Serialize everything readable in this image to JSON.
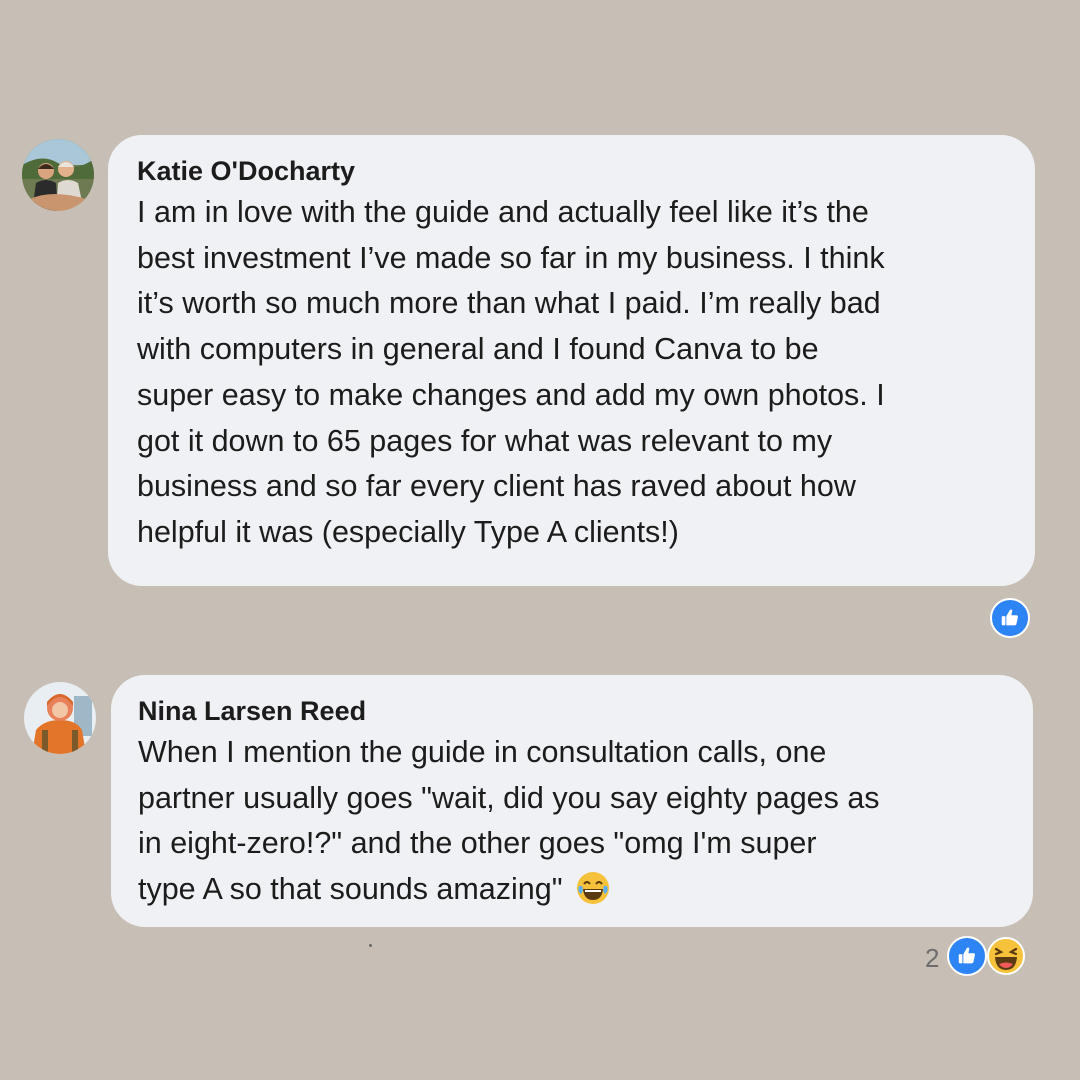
{
  "comments": [
    {
      "author": "Katie O'Docharty",
      "avatar_icon": "profile-photo-avatar",
      "lines": [
        "I am in love with the guide and actually feel like it’s the",
        "best investment I’ve made so far in my business. I think",
        "it’s worth so much more than what I paid. I’m really bad",
        "with computers in general and I found Canva to be",
        "super easy to make changes and add my own photos. I",
        "got it down to 65 pages for what was relevant to my",
        "business and so far every client has raved about how",
        "helpful it was (especially Type A clients!)"
      ],
      "reactions": [
        "like-icon"
      ]
    },
    {
      "author": "Nina Larsen Reed",
      "avatar_icon": "profile-photo-avatar",
      "lines": [
        "When I mention the guide in consultation calls, one",
        "partner usually goes \"wait, did you say eighty pages as",
        "in eight-zero!?\" and the other goes \"omg I'm super",
        "type A so that sounds amazing\""
      ],
      "inline_emoji": "tears-of-joy-emoji-icon",
      "reaction_count": "2",
      "reactions": [
        "like-icon",
        "haha-icon"
      ]
    }
  ],
  "colors": {
    "background": "#c7bfb5",
    "bubble": "#f0f1f5",
    "like_blue": "#2d84f5",
    "haha_yellow": "#f7c23b"
  }
}
